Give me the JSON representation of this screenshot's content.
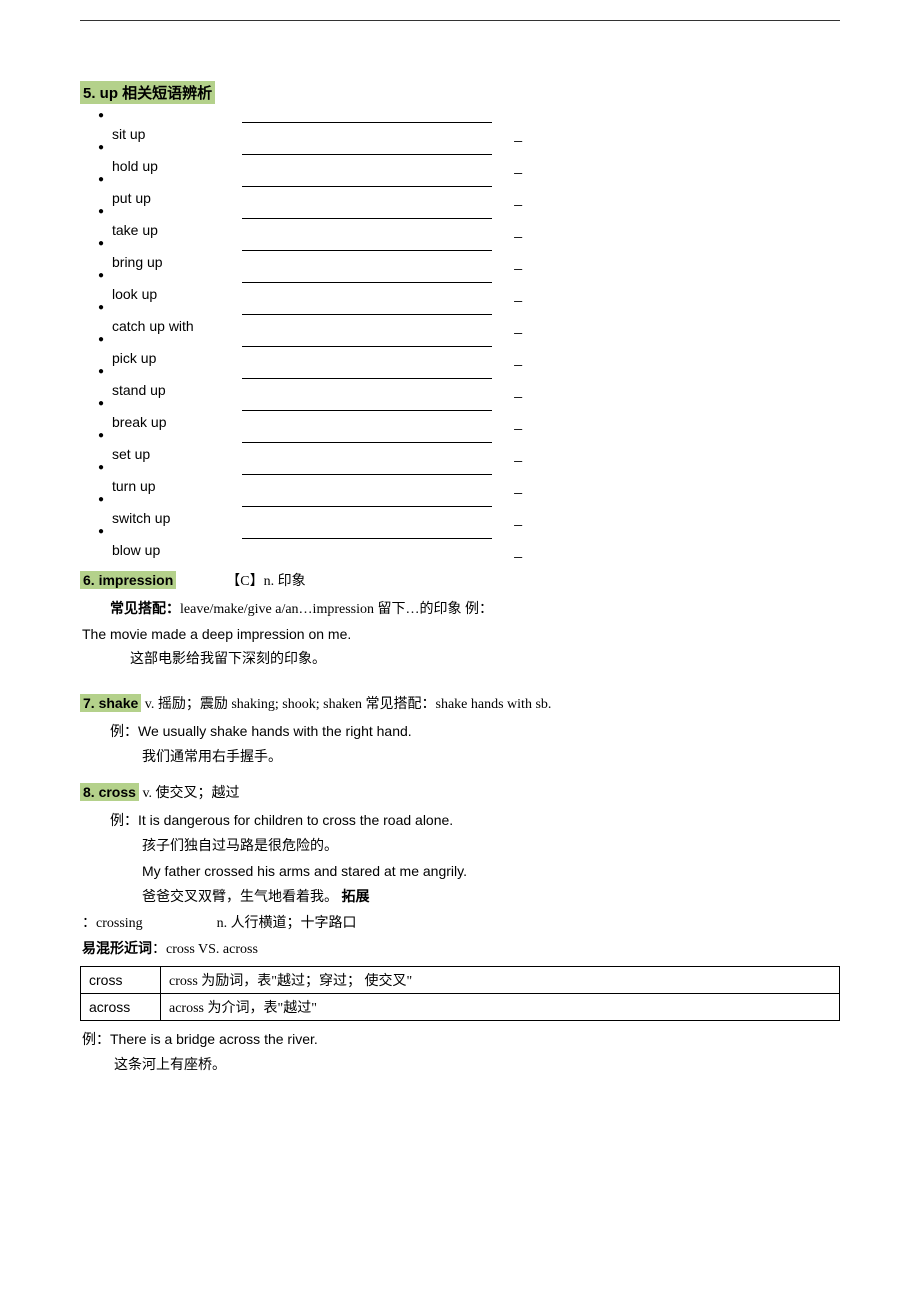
{
  "section5": {
    "title": "5. up 相关短语辨析",
    "items": [
      "sit up",
      "hold up",
      "put up",
      "take up",
      "bring up",
      "look up",
      "catch up with",
      "pick up",
      "stand up",
      "break up",
      "set up",
      "turn up",
      "switch up",
      "blow up"
    ]
  },
  "section6": {
    "num": "6. impression",
    "pos": "【C】n. 印象",
    "collocation_label": "常见搭配：",
    "collocation": "leave/make/give a/an…impression 留下…的印象  例：",
    "example_en": "The movie made a deep impression on me.",
    "example_cn": "这部电影给我留下深刻的印象。"
  },
  "section7": {
    "num": "7. shake",
    "pos": " v. 摇励；震励 shaking; shook; shaken 常见搭配：shake hands with sb.",
    "example_label": "例：",
    "example_en": "We usually shake hands with the right hand.",
    "example_cn": "我们通常用右手握手。"
  },
  "section8": {
    "num": "8. cross",
    "pos": "   v. 使交叉；越过",
    "example_label": "例：",
    "ex1_en": "It is dangerous for children to cross the road alone.",
    "ex1_cn": "孩子们独自过马路是很危险的。",
    "ex2_en": "My father crossed his arms and stared at me angrily.",
    "ex2_cn_a": "爸爸交叉双臂，生气地看着我。 ",
    "ex2_cn_b": "拓展",
    "ext_line": "：crossing",
    "ext_def": "n. 人行横道；十字路口",
    "confuse_label": "易混形近词",
    "confuse_text": "：cross      VS.   across",
    "table": {
      "r1c1": "cross",
      "r1c2": "cross 为励词，表\"越过；穿过； 使交叉\"",
      "r2c1": "across",
      "r2c2": "across 为介词，表\"越过\""
    },
    "tail_label": "例：",
    "tail_en": "There is a bridge across the river.",
    "tail_cn": "这条河上有座桥。"
  }
}
